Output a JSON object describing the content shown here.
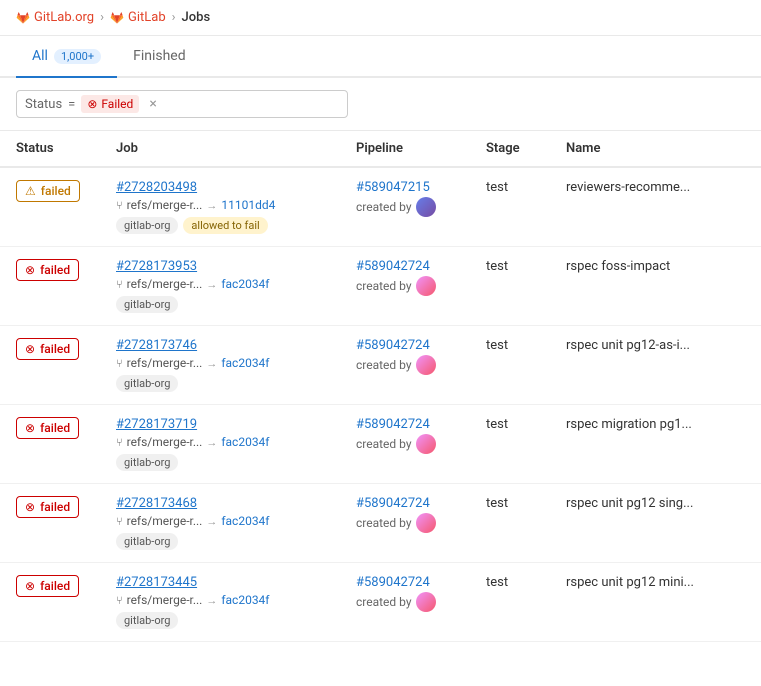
{
  "breadcrumb": {
    "items": [
      {
        "label": "GitLab.org",
        "href": "#"
      },
      {
        "label": "GitLab",
        "href": "#"
      },
      {
        "label": "Jobs"
      }
    ]
  },
  "tabs": [
    {
      "id": "all",
      "label": "All",
      "badge": "1,000+",
      "active": true
    },
    {
      "id": "finished",
      "label": "Finished",
      "badge": "",
      "active": false
    }
  ],
  "filter": {
    "label": "Status",
    "eq": "=",
    "value": "Failed"
  },
  "table": {
    "headers": [
      "Status",
      "Job",
      "Pipeline",
      "Stage",
      "Name"
    ],
    "rows": [
      {
        "status": "failed",
        "status_type": "warn",
        "job_number": "#2728203498",
        "job_ref": "refs/merge-r...",
        "job_commit": "11101dd4",
        "job_tags": [
          "gitlab-org",
          "allowed to fail"
        ],
        "pipeline": "#589047215",
        "pipeline_created": "created by",
        "pipeline_avatar": "1",
        "stage": "test",
        "name": "reviewers-recomme..."
      },
      {
        "status": "failed",
        "status_type": "err",
        "job_number": "#2728173953",
        "job_ref": "refs/merge-r...",
        "job_commit": "fac2034f",
        "job_tags": [
          "gitlab-org"
        ],
        "pipeline": "#589042724",
        "pipeline_created": "created by",
        "pipeline_avatar": "2",
        "stage": "test",
        "name": "rspec foss-impact"
      },
      {
        "status": "failed",
        "status_type": "err",
        "job_number": "#2728173746",
        "job_ref": "refs/merge-r...",
        "job_commit": "fac2034f",
        "job_tags": [
          "gitlab-org"
        ],
        "pipeline": "#589042724",
        "pipeline_created": "created by",
        "pipeline_avatar": "2",
        "stage": "test",
        "name": "rspec unit pg12-as-i..."
      },
      {
        "status": "failed",
        "status_type": "err",
        "job_number": "#2728173719",
        "job_ref": "refs/merge-r...",
        "job_commit": "fac2034f",
        "job_tags": [
          "gitlab-org"
        ],
        "pipeline": "#589042724",
        "pipeline_created": "created by",
        "pipeline_avatar": "2",
        "stage": "test",
        "name": "rspec migration pg1..."
      },
      {
        "status": "failed",
        "status_type": "err",
        "job_number": "#2728173468",
        "job_ref": "refs/merge-r...",
        "job_commit": "fac2034f",
        "job_tags": [
          "gitlab-org"
        ],
        "pipeline": "#589042724",
        "pipeline_created": "created by",
        "pipeline_avatar": "2",
        "stage": "test",
        "name": "rspec unit pg12 sing..."
      },
      {
        "status": "failed",
        "status_type": "err",
        "job_number": "#2728173445",
        "job_ref": "refs/merge-r...",
        "job_commit": "fac2034f",
        "job_tags": [
          "gitlab-org"
        ],
        "pipeline": "#589042724",
        "pipeline_created": "created by",
        "pipeline_avatar": "2",
        "stage": "test",
        "name": "rspec unit pg12 mini..."
      }
    ]
  }
}
